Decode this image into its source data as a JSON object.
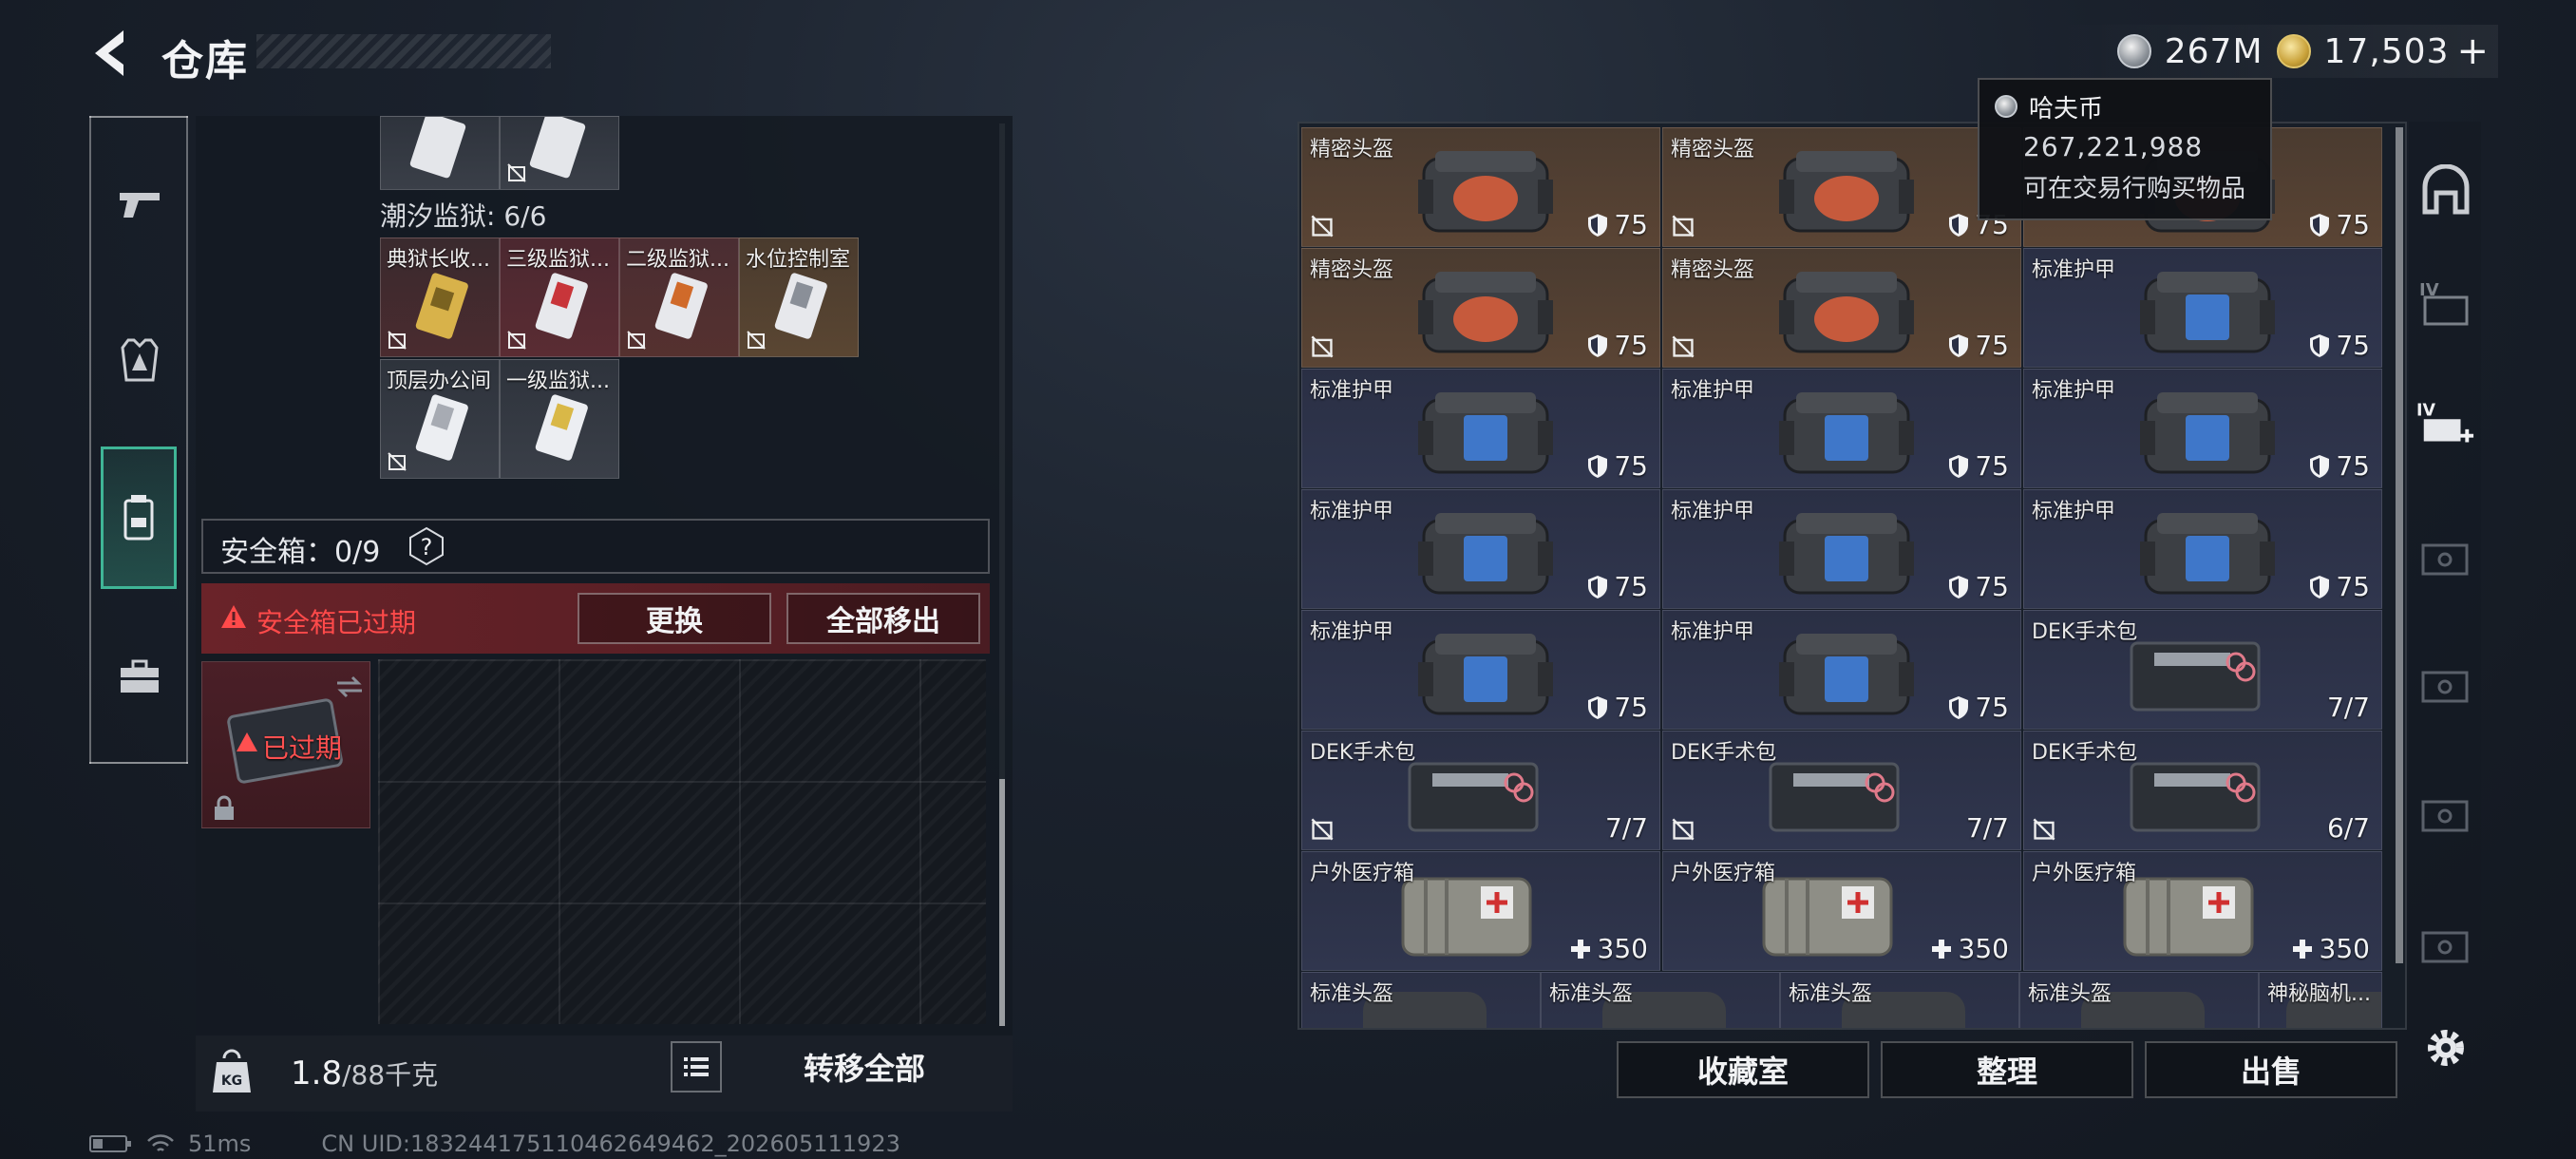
{
  "header": {
    "title": "仓库"
  },
  "currency": {
    "haf_coin_short": "267M",
    "bond_value": "17,503",
    "plus": "+"
  },
  "tooltip": {
    "title": "哈夫币",
    "value": "267,221,988",
    "desc": "可在交易行购买物品"
  },
  "left": {
    "prison_label": "潮汐监狱: 6/6",
    "keys_row1": [
      "典狱长收...",
      "三级监狱...",
      "二级监狱...",
      "水位控制室"
    ],
    "keys_row2": [
      "顶层办公间",
      "一级监狱..."
    ],
    "safebox_label": "安全箱：0/9",
    "help": "?",
    "warn_text": "安全箱已过期",
    "replace_btn": "更换",
    "remove_all_btn": "全部移出",
    "expired_label": "已过期",
    "weight_value": "1.8",
    "weight_max": "/88千克",
    "transfer_all_btn": "转移全部"
  },
  "status": {
    "ping": "51ms",
    "uid": "CN UID:1832441751104626494​62_202605111923"
  },
  "items": [
    {
      "name": "精密头盔",
      "stat": "75",
      "type": "helmet",
      "bg": "brown",
      "nolock": true
    },
    {
      "name": "精密头盔",
      "stat": "75",
      "type": "helmet",
      "bg": "brown",
      "nolock": true
    },
    {
      "name": "",
      "stat": "75",
      "type": "helmet",
      "bg": "brown",
      "nolock": false
    },
    {
      "name": "精密头盔",
      "stat": "75",
      "type": "helmet",
      "bg": "brown",
      "nolock": true
    },
    {
      "name": "精密头盔",
      "stat": "75",
      "type": "helmet",
      "bg": "brown",
      "nolock": true
    },
    {
      "name": "标准护甲",
      "stat": "75",
      "type": "armor",
      "bg": "navy",
      "nolock": false
    },
    {
      "name": "标准护甲",
      "stat": "75",
      "type": "armor",
      "bg": "navy",
      "nolock": false
    },
    {
      "name": "标准护甲",
      "stat": "75",
      "type": "armor",
      "bg": "navy",
      "nolock": false
    },
    {
      "name": "标准护甲",
      "stat": "75",
      "type": "armor",
      "bg": "navy",
      "nolock": false
    },
    {
      "name": "标准护甲",
      "stat": "75",
      "type": "armor",
      "bg": "navy",
      "nolock": false
    },
    {
      "name": "标准护甲",
      "stat": "75",
      "type": "armor",
      "bg": "navy",
      "nolock": false
    },
    {
      "name": "标准护甲",
      "stat": "75",
      "type": "armor",
      "bg": "navy",
      "nolock": false
    },
    {
      "name": "标准护甲",
      "stat": "75",
      "type": "armor",
      "bg": "navy",
      "nolock": false
    },
    {
      "name": "标准护甲",
      "stat": "75",
      "type": "armor",
      "bg": "navy",
      "nolock": false
    },
    {
      "name": "DEK手术包",
      "stat": "7/7",
      "type": "kit",
      "bg": "navy",
      "nolock": false
    },
    {
      "name": "DEK手术包",
      "stat": "7/7",
      "type": "kit",
      "bg": "navy",
      "nolock": true
    },
    {
      "name": "DEK手术包",
      "stat": "7/7",
      "type": "kit",
      "bg": "navy",
      "nolock": true
    },
    {
      "name": "DEK手术包",
      "stat": "6/7",
      "type": "kit",
      "bg": "navy",
      "nolock": true
    },
    {
      "name": "户外医疗箱",
      "stat": "350",
      "type": "med",
      "bg": "navy",
      "nolock": false
    },
    {
      "name": "户外医疗箱",
      "stat": "350",
      "type": "med",
      "bg": "navy",
      "nolock": false
    },
    {
      "name": "户外医疗箱",
      "stat": "350",
      "type": "med",
      "bg": "navy",
      "nolock": false
    }
  ],
  "last_row": [
    "标准头盔",
    "标准头盔",
    "标准头盔",
    "标准头盔",
    "神秘脑机..."
  ],
  "buttons": {
    "collection": "收藏室",
    "organize": "整理",
    "sell": "出售"
  },
  "icons": {
    "back": "back-arrow-icon",
    "haf_coin": "silver-coin-icon",
    "bond": "gold-coin-icon",
    "settings": "gear-icon"
  }
}
